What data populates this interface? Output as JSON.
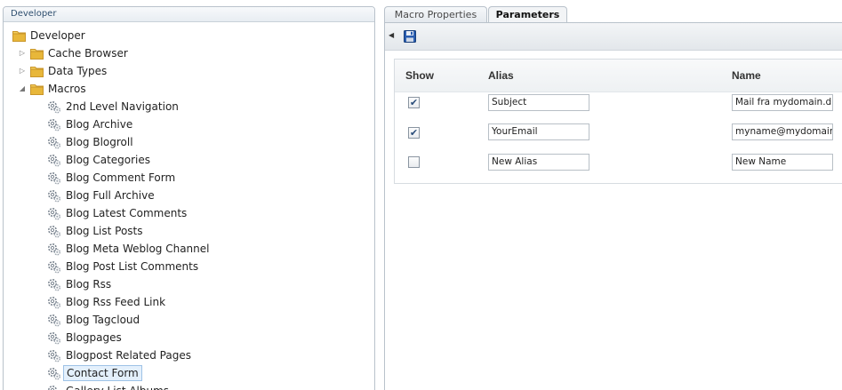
{
  "tree": {
    "header": "Developer",
    "root": "Developer",
    "items": [
      {
        "label": "Cache Browser",
        "type": "folder",
        "expanded": false
      },
      {
        "label": "Data Types",
        "type": "folder",
        "expanded": false
      },
      {
        "label": "Macros",
        "type": "folder",
        "expanded": true
      }
    ],
    "macros": [
      "2nd Level Navigation",
      "Blog Archive",
      "Blog Blogroll",
      "Blog Categories",
      "Blog Comment Form",
      "Blog Full Archive",
      "Blog Latest Comments",
      "Blog List Posts",
      "Blog Meta Weblog Channel",
      "Blog Post List Comments",
      "Blog Rss",
      "Blog Rss Feed Link",
      "Blog Tagcloud",
      "Blogpages",
      "Blogpost Related Pages",
      "Contact Form",
      "Gallery List Albums"
    ],
    "selected_macro": "Contact Form"
  },
  "tabs": [
    {
      "label": "Macro Properties",
      "active": false
    },
    {
      "label": "Parameters",
      "active": true
    }
  ],
  "params": {
    "headers": {
      "show": "Show",
      "alias": "Alias",
      "name": "Name"
    },
    "rows": [
      {
        "show": true,
        "alias": "Subject",
        "name": "Mail fra mydomain.dk"
      },
      {
        "show": true,
        "alias": "YourEmail",
        "name": "myname@mydomain.com"
      },
      {
        "show": false,
        "alias": "New Alias",
        "name": "New Name"
      }
    ]
  },
  "colors": {
    "folder": "#e8b73a",
    "selection": "#e4f0fc",
    "border": "#b9c2cb",
    "save_icon": "#1f4fa0"
  }
}
